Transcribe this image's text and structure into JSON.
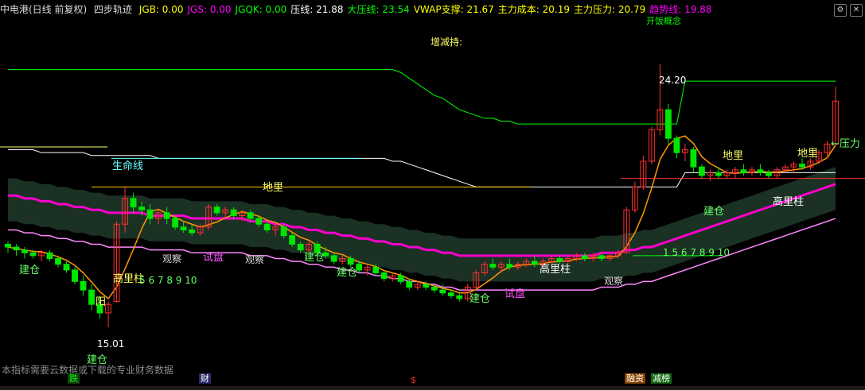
{
  "header": {
    "stock": "中电港(日线 前复权)",
    "indicator": "四步轨迹",
    "items": [
      {
        "label": "JGB: 0.00",
        "color": "#ffff00"
      },
      {
        "label": "JGS: 0.00",
        "color": "#ff00ff"
      },
      {
        "label": "JGQK: 0.00",
        "color": "#00ff00"
      },
      {
        "label": "压线: 21.88",
        "color": "#ffffff"
      },
      {
        "label": "大压线: 23.54",
        "color": "#00ff00"
      },
      {
        "label": "VWAP支撑: 21.67",
        "color": "#ffff00"
      },
      {
        "label": "主力成本: 20.19",
        "color": "#ffff00"
      },
      {
        "label": "主力压力: 20.79",
        "color": "#ffff00"
      },
      {
        "label": "趋势线: 19.88",
        "color": "#ff00ff"
      }
    ],
    "top_partial": "开饭概念"
  },
  "annotations": {
    "zengjianchi": "增减持:",
    "price_high": "24.20",
    "price_low": "15.01",
    "pressure": "←压力",
    "lifeline": "生命线",
    "jiancang": "建仓",
    "shipan": "试盘",
    "guancha": "观察",
    "dili": "地里",
    "gaoliangzhu": "高里柱",
    "yang": "阳",
    "seq": "5 6 7 8 9 10",
    "seq2": "1 5 6 7 8 9 10"
  },
  "footer": {
    "note": "本指标需要云数据或下载的专业财务数据",
    "tags": [
      {
        "label": "跌",
        "color": "#00ff00",
        "bg": "#114411"
      },
      {
        "label": "财",
        "color": "#ffffff",
        "bg": "#2a2a66"
      },
      {
        "label": "$",
        "color": "#ff3030",
        "bg": "#000000"
      },
      {
        "label": "融资",
        "color": "#ffffff",
        "bg": "#884400"
      },
      {
        "label": "减榜",
        "color": "#ffffff",
        "bg": "#116611"
      }
    ]
  },
  "colors": {
    "up": "#ff3030",
    "down": "#00e600",
    "band": "#ff00cc",
    "lifeline": "#66ffff",
    "resist": "#ffffff",
    "green_line": "#00ff00",
    "orange": "#ff9900"
  },
  "chart_data": {
    "type": "candlestick",
    "ylim": [
      14.5,
      25.6
    ],
    "high_marker": 24.2,
    "low_marker": 15.01,
    "candles": [
      [
        17.9,
        18.0,
        17.6,
        17.8
      ],
      [
        17.8,
        17.9,
        17.5,
        17.7
      ],
      [
        17.7,
        17.8,
        17.4,
        17.6
      ],
      [
        17.6,
        17.7,
        17.4,
        17.5
      ],
      [
        17.5,
        17.7,
        17.3,
        17.6
      ],
      [
        17.6,
        17.7,
        17.3,
        17.4
      ],
      [
        17.4,
        17.5,
        17.1,
        17.2
      ],
      [
        17.2,
        17.3,
        16.9,
        17.0
      ],
      [
        17.0,
        17.1,
        16.5,
        16.6
      ],
      [
        16.6,
        16.8,
        16.1,
        16.3
      ],
      [
        16.3,
        16.5,
        15.6,
        15.8
      ],
      [
        15.8,
        16.1,
        15.3,
        15.5
      ],
      [
        15.5,
        15.9,
        15.0,
        15.8
      ],
      [
        15.9,
        18.7,
        15.9,
        18.6
      ],
      [
        18.6,
        19.9,
        18.3,
        19.5
      ],
      [
        19.5,
        19.7,
        19.0,
        19.2
      ],
      [
        19.2,
        19.4,
        18.9,
        19.1
      ],
      [
        19.1,
        19.3,
        18.6,
        18.8
      ],
      [
        18.8,
        19.1,
        18.6,
        19.0
      ],
      [
        19.0,
        19.2,
        18.6,
        18.8
      ],
      [
        18.8,
        18.9,
        18.4,
        18.5
      ],
      [
        18.5,
        18.7,
        18.3,
        18.4
      ],
      [
        18.4,
        18.6,
        18.2,
        18.3
      ],
      [
        18.3,
        18.6,
        18.2,
        18.5
      ],
      [
        18.5,
        19.3,
        18.4,
        19.2
      ],
      [
        19.2,
        19.3,
        18.9,
        19.0
      ],
      [
        19.0,
        19.2,
        18.8,
        19.1
      ],
      [
        19.1,
        19.2,
        18.8,
        18.9
      ],
      [
        18.9,
        19.1,
        18.7,
        19.0
      ],
      [
        19.0,
        19.1,
        18.7,
        18.8
      ],
      [
        18.8,
        18.9,
        18.5,
        18.6
      ],
      [
        18.6,
        18.7,
        18.3,
        18.4
      ],
      [
        18.4,
        18.6,
        18.2,
        18.5
      ],
      [
        18.5,
        18.6,
        18.1,
        18.2
      ],
      [
        18.2,
        18.3,
        17.8,
        17.9
      ],
      [
        17.9,
        18.0,
        17.6,
        17.7
      ],
      [
        17.7,
        18.0,
        17.6,
        17.9
      ],
      [
        17.9,
        18.0,
        17.5,
        17.6
      ],
      [
        17.6,
        17.8,
        17.4,
        17.5
      ],
      [
        17.5,
        17.6,
        17.2,
        17.3
      ],
      [
        17.3,
        17.5,
        17.2,
        17.4
      ],
      [
        17.4,
        17.5,
        17.1,
        17.2
      ],
      [
        17.2,
        17.3,
        16.9,
        17.0
      ],
      [
        17.0,
        17.2,
        16.8,
        17.1
      ],
      [
        17.1,
        17.2,
        16.8,
        16.9
      ],
      [
        16.9,
        17.0,
        16.6,
        16.7
      ],
      [
        16.7,
        16.9,
        16.6,
        16.8
      ],
      [
        16.8,
        16.9,
        16.5,
        16.6
      ],
      [
        16.6,
        16.7,
        16.3,
        16.4
      ],
      [
        16.4,
        16.6,
        16.3,
        16.5
      ],
      [
        16.5,
        16.6,
        16.3,
        16.4
      ],
      [
        16.4,
        16.5,
        16.2,
        16.3
      ],
      [
        16.3,
        16.5,
        16.1,
        16.2
      ],
      [
        16.2,
        16.3,
        16.0,
        16.1
      ],
      [
        16.1,
        16.2,
        15.9,
        16.0
      ],
      [
        16.0,
        16.5,
        15.9,
        16.4
      ],
      [
        16.4,
        17.0,
        16.3,
        16.9
      ],
      [
        16.9,
        17.3,
        16.8,
        17.2
      ],
      [
        17.2,
        17.4,
        17.0,
        17.1
      ],
      [
        17.1,
        17.3,
        16.9,
        17.2
      ],
      [
        17.2,
        17.4,
        17.0,
        17.1
      ],
      [
        17.1,
        17.3,
        17.0,
        17.2
      ],
      [
        17.2,
        17.4,
        17.1,
        17.3
      ],
      [
        17.3,
        17.5,
        17.1,
        17.2
      ],
      [
        17.2,
        17.4,
        17.1,
        17.3
      ],
      [
        17.3,
        17.5,
        17.2,
        17.4
      ],
      [
        17.4,
        17.5,
        17.2,
        17.3
      ],
      [
        17.3,
        17.5,
        17.2,
        17.4
      ],
      [
        17.4,
        17.6,
        17.3,
        17.5
      ],
      [
        17.5,
        17.6,
        17.3,
        17.4
      ],
      [
        17.4,
        17.6,
        17.3,
        17.5
      ],
      [
        17.5,
        17.6,
        17.3,
        17.4
      ],
      [
        17.4,
        17.6,
        17.3,
        17.5
      ],
      [
        17.5,
        17.7,
        17.4,
        17.6
      ],
      [
        17.6,
        19.2,
        17.6,
        19.1
      ],
      [
        19.1,
        20.1,
        19.0,
        19.9
      ],
      [
        19.9,
        21.0,
        19.8,
        20.8
      ],
      [
        20.8,
        22.0,
        20.7,
        21.9
      ],
      [
        21.9,
        24.2,
        21.7,
        22.6
      ],
      [
        22.6,
        22.8,
        21.4,
        21.6
      ],
      [
        21.6,
        21.7,
        20.9,
        21.1
      ],
      [
        21.1,
        21.4,
        20.8,
        21.2
      ],
      [
        21.2,
        21.3,
        20.4,
        20.6
      ],
      [
        20.6,
        20.7,
        20.2,
        20.3
      ],
      [
        20.3,
        20.5,
        20.1,
        20.4
      ],
      [
        20.4,
        20.6,
        20.2,
        20.3
      ],
      [
        20.3,
        20.5,
        20.2,
        20.4
      ],
      [
        20.4,
        20.6,
        20.2,
        20.5
      ],
      [
        20.5,
        20.7,
        20.3,
        20.4
      ],
      [
        20.4,
        20.6,
        20.3,
        20.5
      ],
      [
        20.5,
        20.7,
        20.3,
        20.4
      ],
      [
        20.4,
        20.5,
        20.2,
        20.3
      ],
      [
        20.3,
        20.6,
        20.2,
        20.5
      ],
      [
        20.5,
        20.7,
        20.4,
        20.6
      ],
      [
        20.6,
        20.8,
        20.4,
        20.7
      ],
      [
        20.7,
        20.9,
        20.5,
        20.6
      ],
      [
        20.6,
        20.9,
        20.5,
        20.8
      ],
      [
        20.8,
        21.2,
        20.7,
        21.1
      ],
      [
        21.1,
        21.5,
        20.9,
        21.4
      ],
      [
        21.4,
        23.4,
        21.3,
        22.9
      ]
    ],
    "band_line": [
      19.6,
      19.6,
      19.5,
      19.5,
      19.4,
      19.4,
      19.3,
      19.3,
      19.2,
      19.2,
      19.1,
      19.1,
      19.0,
      19.0,
      19.0,
      19.0,
      19.0,
      18.9,
      18.9,
      18.9,
      18.9,
      18.9,
      18.8,
      18.8,
      18.8,
      18.8,
      18.8,
      18.8,
      18.8,
      18.7,
      18.7,
      18.7,
      18.6,
      18.6,
      18.5,
      18.5,
      18.4,
      18.4,
      18.3,
      18.3,
      18.2,
      18.2,
      18.1,
      18.1,
      18.0,
      18.0,
      17.9,
      17.9,
      17.8,
      17.8,
      17.7,
      17.7,
      17.6,
      17.6,
      17.5,
      17.5,
      17.5,
      17.5,
      17.5,
      17.5,
      17.5,
      17.5,
      17.5,
      17.5,
      17.5,
      17.5,
      17.5,
      17.5,
      17.5,
      17.5,
      17.5,
      17.6,
      17.6,
      17.6,
      17.7,
      17.7,
      17.8,
      17.8,
      17.9,
      18.0,
      18.1,
      18.2,
      18.3,
      18.4,
      18.5,
      18.6,
      18.7,
      18.8,
      18.9,
      19.0,
      19.1,
      19.2,
      19.3,
      19.4,
      19.5,
      19.6,
      19.7,
      19.8,
      19.9,
      20.0
    ],
    "resist_line": [
      21.2,
      21.2,
      21.2,
      21.2,
      21.1,
      21.1,
      21.1,
      21.1,
      21.1,
      21.1,
      21.0,
      21.0,
      21.0,
      21.0,
      21.0,
      21.0,
      21.0,
      21.0,
      20.9,
      20.9,
      20.9,
      20.9,
      20.9,
      20.9,
      20.9,
      20.9,
      20.9,
      20.9,
      20.9,
      20.9,
      20.9,
      20.9,
      20.9,
      20.9,
      20.9,
      20.9,
      20.9,
      20.9,
      20.9,
      20.9,
      20.9,
      20.9,
      20.9,
      20.9,
      20.9,
      20.9,
      20.8,
      20.8,
      20.7,
      20.6,
      20.5,
      20.4,
      20.3,
      20.2,
      20.1,
      20.0,
      19.9,
      19.9,
      19.9,
      19.9,
      19.9,
      19.9,
      19.9,
      19.9,
      19.9,
      19.9,
      19.9,
      19.9,
      19.9,
      19.9,
      19.9,
      19.9,
      19.9,
      19.9,
      19.9,
      19.9,
      19.9,
      19.9,
      19.9,
      19.9,
      19.9,
      20.4,
      20.4,
      20.4,
      20.4,
      20.4,
      20.4,
      20.4,
      20.4,
      20.4,
      20.4,
      20.4,
      20.4,
      20.4,
      20.4,
      20.4,
      20.4,
      20.4,
      20.4,
      20.4
    ],
    "green_line": [
      24.0,
      24.0,
      24.0,
      24.0,
      24.0,
      24.0,
      24.0,
      24.0,
      24.0,
      24.0,
      24.0,
      24.0,
      24.0,
      24.0,
      24.0,
      24.0,
      24.0,
      24.0,
      24.0,
      24.0,
      24.0,
      24.0,
      24.0,
      24.0,
      24.0,
      24.0,
      24.0,
      24.0,
      24.0,
      24.0,
      24.0,
      24.0,
      24.0,
      24.0,
      24.0,
      24.0,
      24.0,
      24.0,
      24.0,
      24.0,
      24.0,
      24.0,
      24.0,
      24.0,
      24.0,
      24.0,
      24.0,
      23.9,
      23.7,
      23.5,
      23.3,
      23.1,
      23.0,
      22.8,
      22.6,
      22.5,
      22.4,
      22.3,
      22.3,
      22.2,
      22.2,
      22.1,
      22.1,
      22.1,
      22.1,
      22.1,
      22.1,
      22.1,
      22.1,
      22.1,
      22.1,
      22.1,
      22.1,
      22.1,
      22.1,
      22.1,
      22.1,
      22.1,
      22.1,
      22.1,
      22.1,
      23.6,
      23.6,
      23.6,
      23.6,
      23.6,
      23.6,
      23.6,
      23.6,
      23.6,
      23.6,
      23.6,
      23.6,
      23.6,
      23.6,
      23.6,
      23.6,
      23.6,
      23.6,
      23.6
    ]
  }
}
